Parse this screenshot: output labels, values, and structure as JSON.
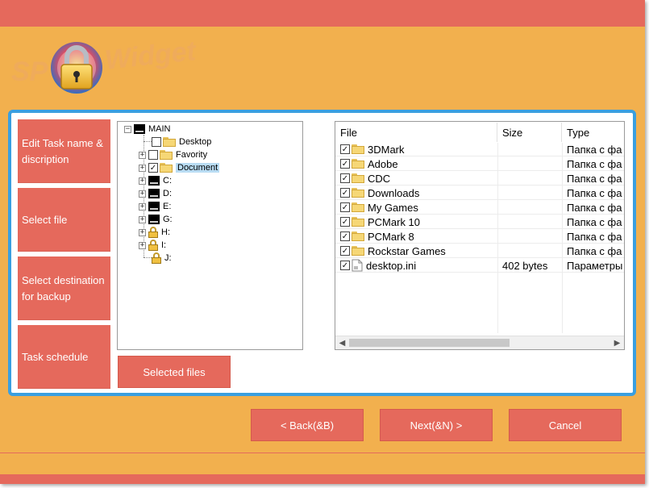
{
  "logo": {
    "text_left": "SP",
    "text_right": "Widget"
  },
  "steps": [
    {
      "label": "Edit Task name & discription"
    },
    {
      "label": "Select file"
    },
    {
      "label": "Select destination for backup"
    },
    {
      "label": "Task schedule"
    }
  ],
  "tree": {
    "root": "MAIN",
    "folders": [
      {
        "label": "Desktop",
        "checked": false
      },
      {
        "label": "Favority",
        "checked": false
      },
      {
        "label": "Document",
        "checked": true,
        "selected": true
      }
    ],
    "drives": [
      {
        "label": "C:",
        "type": "drive"
      },
      {
        "label": "D:",
        "type": "drive"
      },
      {
        "label": "E:",
        "type": "drive"
      },
      {
        "label": "G:",
        "type": "drive"
      },
      {
        "label": "H:",
        "type": "locked"
      },
      {
        "label": "I:",
        "type": "locked"
      },
      {
        "label": "J:",
        "type": "locked"
      }
    ]
  },
  "file_list": {
    "columns": [
      "File",
      "Size",
      "Type"
    ],
    "rows": [
      {
        "name": "3DMark",
        "size": "",
        "type": "Папка с фа",
        "kind": "folder"
      },
      {
        "name": "Adobe",
        "size": "",
        "type": "Папка с фа",
        "kind": "folder"
      },
      {
        "name": "CDC",
        "size": "",
        "type": "Папка с фа",
        "kind": "folder"
      },
      {
        "name": "Downloads",
        "size": "",
        "type": "Папка с фа",
        "kind": "folder"
      },
      {
        "name": "My Games",
        "size": "",
        "type": "Папка с фа",
        "kind": "folder"
      },
      {
        "name": "PCMark 10",
        "size": "",
        "type": "Папка с фа",
        "kind": "folder"
      },
      {
        "name": "PCMark 8",
        "size": "",
        "type": "Папка с фа",
        "kind": "folder"
      },
      {
        "name": "Rockstar Games",
        "size": "",
        "type": "Папка с фа",
        "kind": "folder"
      },
      {
        "name": "desktop.ini",
        "size": "402 bytes",
        "type": "Параметры",
        "kind": "file"
      }
    ]
  },
  "buttons": {
    "selected_files": "Selected files",
    "back": "< Back(&B)",
    "next": "Next(&N) >",
    "cancel": "Cancel"
  },
  "colors": {
    "background": "#f2b04e",
    "accent": "#e5695c",
    "panel_border": "#3a9fe0",
    "selection": "#b9dcf3"
  }
}
